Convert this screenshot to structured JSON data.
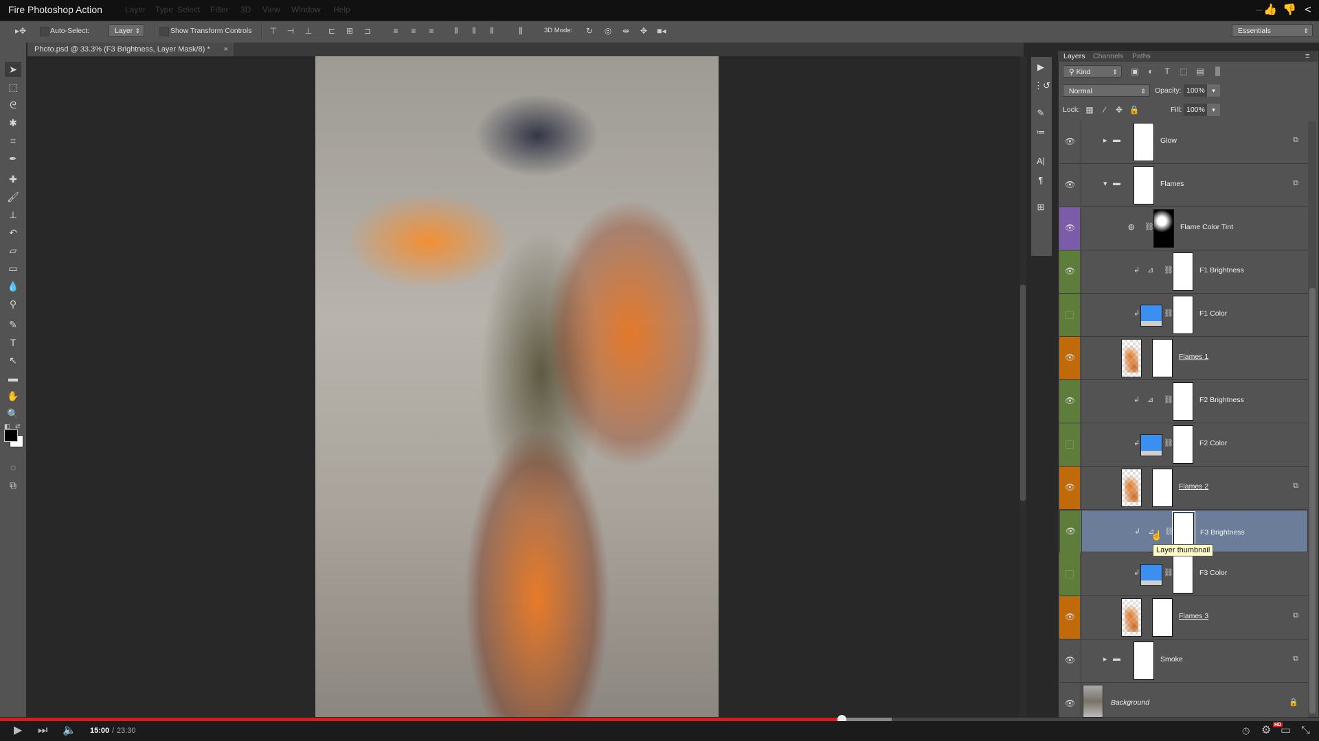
{
  "window": {
    "title": "Fire Photoshop Action",
    "buttons": [
      "minimize",
      "restore",
      "close"
    ]
  },
  "overlay_actions": {
    "like": "thumbs-up-icon",
    "dislike": "thumbs-down-icon",
    "share": "share-icon"
  },
  "menu": [
    "Layer",
    "Type",
    "Select",
    "Filter",
    "3D",
    "View",
    "Window",
    "Help"
  ],
  "options": {
    "auto_select_label": "Auto-Select:",
    "auto_select_checked": false,
    "auto_select_target": "Layer",
    "show_transform_label": "Show Transform Controls",
    "show_transform_checked": false,
    "mode3d_label": "3D Mode:",
    "workspace": "Essentials"
  },
  "document": {
    "tab_title": "Photo.psd @ 33.3% (F3 Brightness, Layer Mask/8) *",
    "close": "×"
  },
  "tools": [
    "move",
    "marquee",
    "lasso",
    "quick-selection",
    "crop",
    "eyedropper",
    "healing-brush",
    "brush",
    "clone-stamp",
    "history-brush",
    "eraser",
    "gradient",
    "blur",
    "dodge",
    "pen",
    "type",
    "path-selection",
    "rectangle",
    "hand",
    "zoom"
  ],
  "layers_panel": {
    "tabs": [
      {
        "label": "Layers",
        "active": true
      },
      {
        "label": "Channels",
        "active": false
      },
      {
        "label": "Paths",
        "active": false
      }
    ],
    "filter_kind": "Kind",
    "blend_mode": "Normal",
    "opacity_label": "Opacity:",
    "opacity": "100%",
    "lock_label": "Lock:",
    "fill_label": "Fill:",
    "fill": "100%",
    "layers": [
      {
        "name": "Glow",
        "type": "group",
        "expanded": false,
        "visible": true,
        "color": "none"
      },
      {
        "name": "Flames",
        "type": "group",
        "expanded": true,
        "visible": true,
        "color": "none"
      },
      {
        "name": "Flame Color Tint",
        "type": "adjustment-mask",
        "visible": true,
        "color": "#7a5ca8"
      },
      {
        "name": "F1 Brightness",
        "type": "curves",
        "clipped": true,
        "visible": true,
        "color": "#5e7d3a"
      },
      {
        "name": "F1 Color",
        "type": "color-fill",
        "clipped": true,
        "visible": false,
        "color": "#5e7d3a"
      },
      {
        "name": "Flames 1",
        "type": "pixel",
        "visible": true,
        "color": "#c06a0c"
      },
      {
        "name": "F2 Brightness",
        "type": "curves",
        "clipped": true,
        "visible": true,
        "color": "#5e7d3a"
      },
      {
        "name": "F2 Color",
        "type": "color-fill",
        "clipped": true,
        "visible": false,
        "color": "#5e7d3a"
      },
      {
        "name": "Flames 2",
        "type": "pixel",
        "visible": true,
        "color": "#c06a0c"
      },
      {
        "name": "F3 Brightness",
        "type": "curves",
        "clipped": true,
        "visible": true,
        "color": "#5e7d3a",
        "selected": true
      },
      {
        "name": "F3 Color",
        "type": "color-fill",
        "clipped": true,
        "visible": false,
        "color": "#5e7d3a"
      },
      {
        "name": "Flames 3",
        "type": "pixel",
        "visible": true,
        "color": "#c06a0c"
      },
      {
        "name": "Smoke",
        "type": "group",
        "expanded": false,
        "visible": true,
        "color": "none"
      },
      {
        "name": "Background",
        "type": "background",
        "visible": true,
        "color": "none",
        "locked": true
      }
    ],
    "tooltip": "Layer thumbnail"
  },
  "video": {
    "current_time": "15:00",
    "separator": "/",
    "total_time": "23:30",
    "played_fraction": 0.638,
    "buffered_fraction": 0.676,
    "hd_badge": "HD",
    "played_color": "#d41f1f"
  }
}
